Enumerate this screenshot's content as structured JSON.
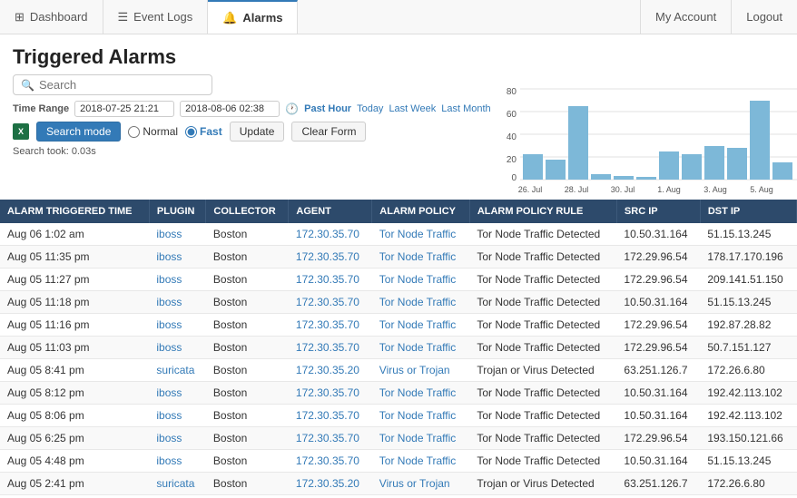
{
  "nav": {
    "items": [
      {
        "id": "dashboard",
        "label": "Dashboard",
        "icon": "grid-icon",
        "active": false
      },
      {
        "id": "event-logs",
        "label": "Event Logs",
        "icon": "list-icon",
        "active": false
      },
      {
        "id": "alarms",
        "label": "Alarms",
        "icon": "alarm-icon",
        "active": true
      }
    ],
    "right_items": [
      {
        "id": "my-account",
        "label": "My Account"
      },
      {
        "id": "logout",
        "label": "Logout"
      }
    ]
  },
  "page": {
    "title": "Triggered Alarms"
  },
  "search": {
    "placeholder": "Search",
    "time_range_label": "Time Range",
    "time_start": "2018-07-25 21:21",
    "time_end": "2018-08-06 02:38",
    "time_links": [
      "Past Hour",
      "Today",
      "Last Week",
      "Last Month"
    ],
    "search_mode_label": "Search mode",
    "normal_label": "Normal",
    "fast_label": "Fast",
    "update_label": "Update",
    "clear_form_label": "Clear Form",
    "search_took": "Search took: 0.03s"
  },
  "chart": {
    "labels": [
      "26. Jul",
      "28. Jul",
      "30. Jul",
      "1. Aug",
      "3. Aug",
      "5. Aug"
    ],
    "y_labels": [
      "0",
      "20",
      "40",
      "60",
      "80"
    ],
    "bars": [
      {
        "label": "26. Jul",
        "value": 22
      },
      {
        "label": "27. Jul",
        "value": 18
      },
      {
        "label": "28. Jul",
        "value": 65
      },
      {
        "label": "29. Jul",
        "value": 5
      },
      {
        "label": "30. Jul",
        "value": 3
      },
      {
        "label": "31. Jul",
        "value": 2
      },
      {
        "label": "1. Aug",
        "value": 25
      },
      {
        "label": "2. Aug",
        "value": 22
      },
      {
        "label": "3. Aug",
        "value": 30
      },
      {
        "label": "4. Aug",
        "value": 28
      },
      {
        "label": "5. Aug",
        "value": 70
      },
      {
        "label": "6. Aug",
        "value": 15
      }
    ],
    "max": 80
  },
  "table": {
    "columns": [
      "ALARM TRIGGERED TIME",
      "PLUGIN",
      "COLLECTOR",
      "AGENT",
      "ALARM POLICY",
      "ALARM POLICY RULE",
      "SRC IP",
      "DST IP"
    ],
    "rows": [
      {
        "time": "Aug 06 1:02 am",
        "plugin": "iboss",
        "collector": "Boston",
        "agent": "172.30.35.70",
        "policy": "Tor Node Traffic",
        "rule": "Tor Node Traffic Detected",
        "src": "10.50.31.164",
        "dst": "51.15.13.245"
      },
      {
        "time": "Aug 05 11:35 pm",
        "plugin": "iboss",
        "collector": "Boston",
        "agent": "172.30.35.70",
        "policy": "Tor Node Traffic",
        "rule": "Tor Node Traffic Detected",
        "src": "172.29.96.54",
        "dst": "178.17.170.196"
      },
      {
        "time": "Aug 05 11:27 pm",
        "plugin": "iboss",
        "collector": "Boston",
        "agent": "172.30.35.70",
        "policy": "Tor Node Traffic",
        "rule": "Tor Node Traffic Detected",
        "src": "172.29.96.54",
        "dst": "209.141.51.150"
      },
      {
        "time": "Aug 05 11:18 pm",
        "plugin": "iboss",
        "collector": "Boston",
        "agent": "172.30.35.70",
        "policy": "Tor Node Traffic",
        "rule": "Tor Node Traffic Detected",
        "src": "10.50.31.164",
        "dst": "51.15.13.245"
      },
      {
        "time": "Aug 05 11:16 pm",
        "plugin": "iboss",
        "collector": "Boston",
        "agent": "172.30.35.70",
        "policy": "Tor Node Traffic",
        "rule": "Tor Node Traffic Detected",
        "src": "172.29.96.54",
        "dst": "192.87.28.82"
      },
      {
        "time": "Aug 05 11:03 pm",
        "plugin": "iboss",
        "collector": "Boston",
        "agent": "172.30.35.70",
        "policy": "Tor Node Traffic",
        "rule": "Tor Node Traffic Detected",
        "src": "172.29.96.54",
        "dst": "50.7.151.127"
      },
      {
        "time": "Aug 05 8:41 pm",
        "plugin": "suricata",
        "collector": "Boston",
        "agent": "172.30.35.20",
        "policy": "Virus or Trojan",
        "rule": "Trojan or Virus Detected",
        "src": "63.251.126.7",
        "dst": "172.26.6.80"
      },
      {
        "time": "Aug 05 8:12 pm",
        "plugin": "iboss",
        "collector": "Boston",
        "agent": "172.30.35.70",
        "policy": "Tor Node Traffic",
        "rule": "Tor Node Traffic Detected",
        "src": "10.50.31.164",
        "dst": "192.42.113.102"
      },
      {
        "time": "Aug 05 8:06 pm",
        "plugin": "iboss",
        "collector": "Boston",
        "agent": "172.30.35.70",
        "policy": "Tor Node Traffic",
        "rule": "Tor Node Traffic Detected",
        "src": "10.50.31.164",
        "dst": "192.42.113.102"
      },
      {
        "time": "Aug 05 6:25 pm",
        "plugin": "iboss",
        "collector": "Boston",
        "agent": "172.30.35.70",
        "policy": "Tor Node Traffic",
        "rule": "Tor Node Traffic Detected",
        "src": "172.29.96.54",
        "dst": "193.150.121.66"
      },
      {
        "time": "Aug 05 4:48 pm",
        "plugin": "iboss",
        "collector": "Boston",
        "agent": "172.30.35.70",
        "policy": "Tor Node Traffic",
        "rule": "Tor Node Traffic Detected",
        "src": "10.50.31.164",
        "dst": "51.15.13.245"
      },
      {
        "time": "Aug 05 2:41 pm",
        "plugin": "suricata",
        "collector": "Boston",
        "agent": "172.30.35.20",
        "policy": "Virus or Trojan",
        "rule": "Trojan or Virus Detected",
        "src": "63.251.126.7",
        "dst": "172.26.6.80"
      }
    ]
  }
}
